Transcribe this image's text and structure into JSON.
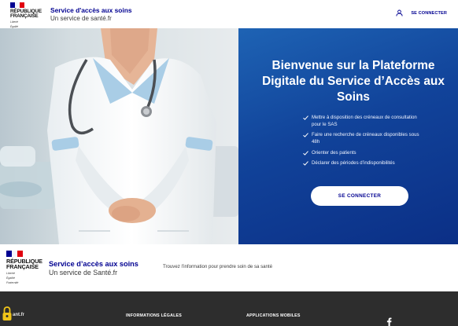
{
  "header": {
    "republic_name": [
      "RÉPUBLIQUE",
      "FRANÇAISE"
    ],
    "motto": [
      "Liberté",
      "Égalité",
      "Fraternité"
    ],
    "service_title": "Service d'accès aux soins",
    "service_subtitle": "Un service de santé.fr",
    "login_label": "SE CONNECTER"
  },
  "hero": {
    "title": "Bienvenue sur la Plateforme Digitale du Service d’Accès aux Soins",
    "features": [
      "Mettre à disposition des créneaux de consultation pour le SAS",
      "Faire une recherche de créneaux disponibles sous 48h",
      "Orienter des patients",
      "Déclarer des périodes d’indisponibilités"
    ],
    "cta_label": "SE CONNECTER",
    "panel_color": "#0f3f99"
  },
  "brand_band": {
    "republic_name": [
      "RÉPUBLIQUE",
      "FRANÇAISE"
    ],
    "motto": [
      "Liberté",
      "Égalité",
      "Fraternité"
    ],
    "service_title": "Service d’accès aux soins",
    "service_subtitle": "Un service de Santé.fr",
    "description": "Trouvez l’information pour prendre soin de sa santé"
  },
  "footer": {
    "partner_text": "ant.fr",
    "legal_heading": "INFORMATIONS LÉGALES",
    "apps_heading": "APPLICATIONS MOBILES",
    "social_icon": "facebook-icon"
  },
  "colors": {
    "brand_blue": "#000091",
    "hero_gradient_start": "#1e63b4",
    "hero_gradient_end": "#0b2f86",
    "footer_bg": "#2d2d2d",
    "flag_red": "#e1000f"
  }
}
